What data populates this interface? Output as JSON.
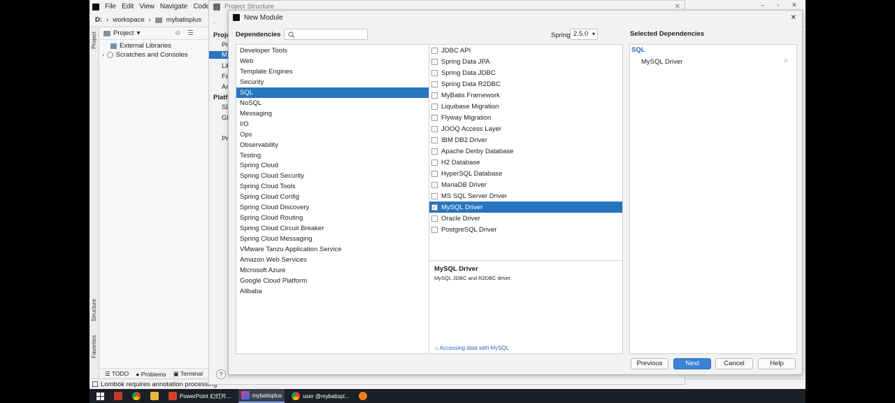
{
  "ide": {
    "menu": [
      "File",
      "Edit",
      "View",
      "Navigate",
      "Code",
      "A"
    ],
    "breadcrumb": {
      "drive": "D:",
      "folder1": "workspace",
      "folder2": "mybatisplus"
    },
    "project_header": "Project",
    "tree": [
      "External Libraries",
      "Scratches and Consoles"
    ],
    "left_tabs": {
      "project": "Project",
      "structure": "Structure",
      "favorites": "Favorites"
    },
    "bottom_tabs": [
      "TODO",
      "Problems",
      "Terminal"
    ],
    "status_text": "Lombok requires annotation processing"
  },
  "project_structure": {
    "title": "Project Structure",
    "sidebar": [
      "Proje",
      "Pr",
      "M",
      "Lib",
      "Fa",
      "Ar",
      "Platfo",
      "SD",
      "Gl",
      "Pr"
    ]
  },
  "dialog": {
    "title": "New Module",
    "dependencies_label": "Dependencies",
    "search_placeholder": "",
    "spring_boot_label": "Spring Boot",
    "spring_boot_version": "2.5.0",
    "selected_label": "Selected Dependencies",
    "categories": [
      "Developer Tools",
      "Web",
      "Template Engines",
      "Security",
      "SQL",
      "NoSQL",
      "Messaging",
      "I/O",
      "Ops",
      "Observability",
      "Testing",
      "Spring Cloud",
      "Spring Cloud Security",
      "Spring Cloud Tools",
      "Spring Cloud Config",
      "Spring Cloud Discovery",
      "Spring Cloud Routing",
      "Spring Cloud Circuit Breaker",
      "Spring Cloud Messaging",
      "VMware Tanzu Application Service",
      "Amazon Web Services",
      "Microsoft Azure",
      "Google Cloud Platform",
      "Alibaba"
    ],
    "selected_category": "SQL",
    "dependencies": [
      {
        "label": "JDBC API",
        "checked": false
      },
      {
        "label": "Spring Data JPA",
        "checked": false
      },
      {
        "label": "Spring Data JDBC",
        "checked": false
      },
      {
        "label": "Spring Data R2DBC",
        "checked": false
      },
      {
        "label": "MyBatis Framework",
        "checked": false
      },
      {
        "label": "Liquibase Migration",
        "checked": false
      },
      {
        "label": "Flyway Migration",
        "checked": false
      },
      {
        "label": "JOOQ Access Layer",
        "checked": false
      },
      {
        "label": "IBM DB2 Driver",
        "checked": false
      },
      {
        "label": "Apache Derby Database",
        "checked": false
      },
      {
        "label": "H2 Database",
        "checked": false
      },
      {
        "label": "HyperSQL Database",
        "checked": false
      },
      {
        "label": "MariaDB Driver",
        "checked": false
      },
      {
        "label": "MS SQL Server Driver",
        "checked": false
      },
      {
        "label": "MySQL Driver",
        "checked": true
      },
      {
        "label": "Oracle Driver",
        "checked": false
      },
      {
        "label": "PostgreSQL Driver",
        "checked": false
      }
    ],
    "description": {
      "title": "MySQL Driver",
      "text": "MySQL JDBC and R2DBC driver.",
      "link": "Accessing data with MySQL"
    },
    "selected": {
      "group": "SQL",
      "items": [
        "MySQL Driver"
      ]
    },
    "buttons": {
      "previous": "Previous",
      "next": "Next",
      "cancel": "Cancel",
      "help": "Help"
    },
    "help_icon_text": "?"
  },
  "taskbar": {
    "items": [
      {
        "label": "PowerPoint 幻灯片..."
      },
      {
        "label": "mybatisplus"
      },
      {
        "label": "user @mybatispl..."
      }
    ]
  }
}
